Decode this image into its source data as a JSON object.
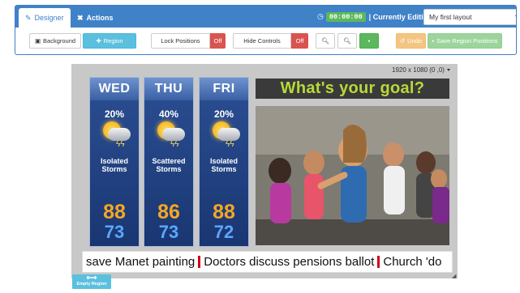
{
  "header": {
    "tabs": [
      {
        "label": "Designer",
        "icon": "edit-icon"
      },
      {
        "label": "Actions",
        "icon": "tools-icon"
      }
    ],
    "timer": "00:00:00",
    "editing_label": "| Currently Editing",
    "layout_select": "My first layout"
  },
  "toolbar": {
    "background_label": "Background",
    "region_label": "Region",
    "lock_label": "Lock Positions",
    "lock_state": "Off",
    "hide_label": "Hide Controls",
    "hide_state": "Off",
    "undo_label": "Undo",
    "save_positions_label": "Save Region Positions"
  },
  "canvas": {
    "resolution": "1920 x 1080 (0 ,0)"
  },
  "weather": [
    {
      "day": "WED",
      "pct": "20%",
      "cond1": "Isolated",
      "cond2": "Storms",
      "hi": "88",
      "lo": "73"
    },
    {
      "day": "THU",
      "pct": "40%",
      "cond1": "Scattered",
      "cond2": "Storms",
      "hi": "86",
      "lo": "73"
    },
    {
      "day": "FRI",
      "pct": "20%",
      "cond1": "Isolated",
      "cond2": "Storms",
      "hi": "88",
      "lo": "72"
    }
  ],
  "goal_text": "What's your goal?",
  "ticker": {
    "items": [
      "save Manet painting",
      "Doctors discuss pensions ballot",
      "Church 'do"
    ]
  },
  "empty_region_label": "Empty Region",
  "colors": {
    "brand": "#3f82c8",
    "info": "#5bc0de",
    "success": "#5cb85c",
    "danger": "#d9534f",
    "warning": "#f0ad4e",
    "goal_text": "#b7d93a"
  }
}
